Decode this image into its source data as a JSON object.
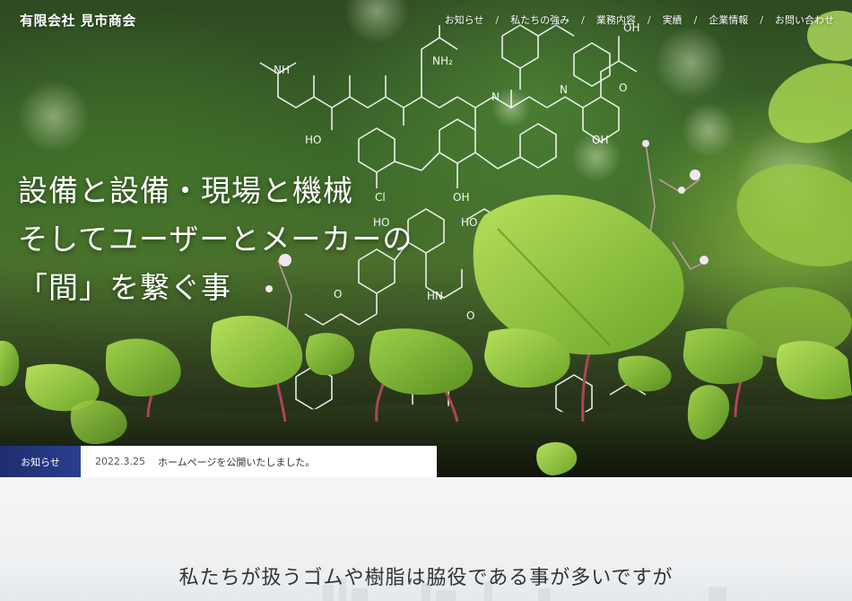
{
  "header": {
    "logo": "有限会社 見市商会",
    "nav": [
      {
        "label": "お知らせ",
        "name": "nav-news"
      },
      {
        "label": "私たちの強み",
        "name": "nav-strengths"
      },
      {
        "label": "業務内容",
        "name": "nav-services"
      },
      {
        "label": "実績",
        "name": "nav-results"
      },
      {
        "label": "企業情報",
        "name": "nav-company"
      },
      {
        "label": "お問い合わせ",
        "name": "nav-contact"
      }
    ],
    "separator": "/"
  },
  "hero": {
    "headline": [
      "設備と設備・現場と機械",
      "そしてユーザーとメーカーの",
      "「間」を繋ぐ事"
    ],
    "molecule_labels": [
      "NH",
      "NH₂",
      "OH",
      "HO",
      "Cl",
      "O",
      "N",
      "H"
    ]
  },
  "news": {
    "label": "お知らせ",
    "date": "2022.3.25",
    "text": "ホームページを公開いたしました。"
  },
  "intro": {
    "heading": "私たちが扱うゴムや樹脂は脇役である事が多いですが"
  },
  "colors": {
    "news_label_bg": "#1f2d6e",
    "leaf_green": "#8fc43b",
    "text_dark": "#333333"
  }
}
